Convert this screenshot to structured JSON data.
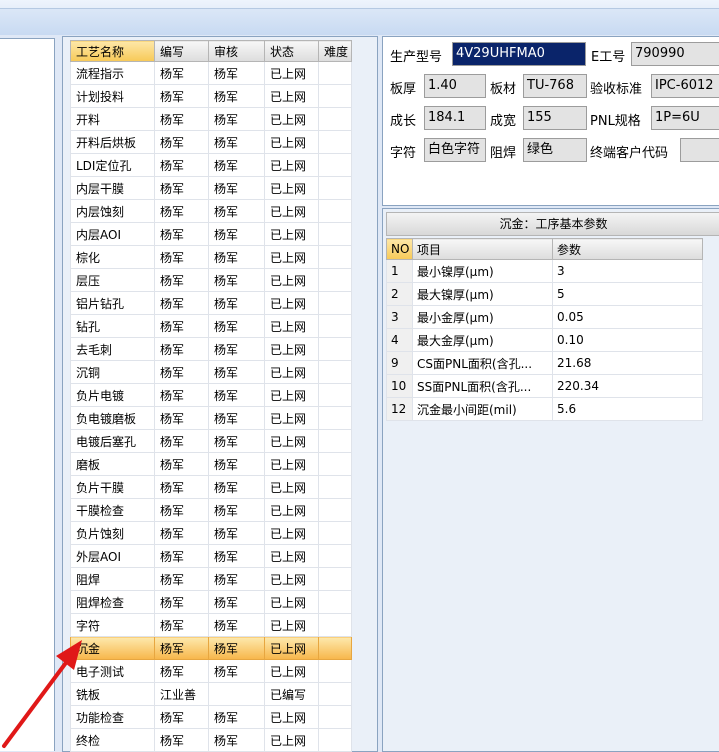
{
  "process_table": {
    "headers": [
      "工艺名称",
      "编写",
      "审核",
      "状态",
      "难度"
    ],
    "rows": [
      [
        "流程指示",
        "杨军",
        "杨军",
        "已上网",
        ""
      ],
      [
        "计划投料",
        "杨军",
        "杨军",
        "已上网",
        ""
      ],
      [
        "开料",
        "杨军",
        "杨军",
        "已上网",
        ""
      ],
      [
        "开料后烘板",
        "杨军",
        "杨军",
        "已上网",
        ""
      ],
      [
        "LDI定位孔",
        "杨军",
        "杨军",
        "已上网",
        ""
      ],
      [
        "内层干膜",
        "杨军",
        "杨军",
        "已上网",
        ""
      ],
      [
        "内层蚀刻",
        "杨军",
        "杨军",
        "已上网",
        ""
      ],
      [
        "内层AOI",
        "杨军",
        "杨军",
        "已上网",
        ""
      ],
      [
        "棕化",
        "杨军",
        "杨军",
        "已上网",
        ""
      ],
      [
        "层压",
        "杨军",
        "杨军",
        "已上网",
        ""
      ],
      [
        "铝片钻孔",
        "杨军",
        "杨军",
        "已上网",
        ""
      ],
      [
        "钻孔",
        "杨军",
        "杨军",
        "已上网",
        ""
      ],
      [
        "去毛刺",
        "杨军",
        "杨军",
        "已上网",
        ""
      ],
      [
        "沉铜",
        "杨军",
        "杨军",
        "已上网",
        ""
      ],
      [
        "负片电镀",
        "杨军",
        "杨军",
        "已上网",
        ""
      ],
      [
        "负电镀磨板",
        "杨军",
        "杨军",
        "已上网",
        ""
      ],
      [
        "电镀后塞孔",
        "杨军",
        "杨军",
        "已上网",
        ""
      ],
      [
        "磨板",
        "杨军",
        "杨军",
        "已上网",
        ""
      ],
      [
        "负片干膜",
        "杨军",
        "杨军",
        "已上网",
        ""
      ],
      [
        "干膜检查",
        "杨军",
        "杨军",
        "已上网",
        ""
      ],
      [
        "负片蚀刻",
        "杨军",
        "杨军",
        "已上网",
        ""
      ],
      [
        "外层AOI",
        "杨军",
        "杨军",
        "已上网",
        ""
      ],
      [
        "阻焊",
        "杨军",
        "杨军",
        "已上网",
        ""
      ],
      [
        "阻焊检查",
        "杨军",
        "杨军",
        "已上网",
        ""
      ],
      [
        "字符",
        "杨军",
        "杨军",
        "已上网",
        ""
      ],
      [
        "沉金",
        "杨军",
        "杨军",
        "已上网",
        ""
      ],
      [
        "电子测试",
        "杨军",
        "杨军",
        "已上网",
        ""
      ],
      [
        "铣板",
        "江业善",
        "",
        "已编写",
        ""
      ],
      [
        "功能检查",
        "杨军",
        "杨军",
        "已上网",
        ""
      ],
      [
        "终检",
        "杨军",
        "杨军",
        "已上网",
        ""
      ]
    ],
    "selected_row": 25
  },
  "info": {
    "model_label": "生产型号",
    "model_value": "4V29UHFMA0",
    "eno_label": "E工号",
    "eno_value": "790990",
    "thickness_label": "板厚",
    "thickness_value": "1.40",
    "material_label": "板材",
    "material_value": "TU-768",
    "standard_label": "验收标准",
    "standard_value": "IPC-6012",
    "length_label": "成长",
    "length_value": "184.1",
    "width_label": "成宽",
    "width_value": "155",
    "pnl_label": "PNL规格",
    "pnl_value": "1P=6U",
    "char_label": "字符",
    "char_value": "白色字符",
    "mask_label": "阻焊",
    "mask_value": "绿色",
    "customer_label": "终端客户代码",
    "customer_value": ""
  },
  "params": {
    "title": "沉金：工序基本参数",
    "headers": [
      "NO",
      "项目",
      "参数"
    ],
    "rows": [
      [
        "1",
        "最小镍厚(μm)",
        "3"
      ],
      [
        "2",
        "最大镍厚(μm)",
        "5"
      ],
      [
        "3",
        "最小金厚(μm)",
        "0.05"
      ],
      [
        "4",
        "最大金厚(μm)",
        "0.10"
      ],
      [
        "9",
        "CS面PNL面积(含孔...",
        "21.68"
      ],
      [
        "10",
        "SS面PNL面积(含孔...",
        "220.34"
      ],
      [
        "12",
        "沉金最小间距(mil)",
        "5.6"
      ]
    ]
  },
  "colors": {
    "selected_row": "#f7b64a",
    "annotation_arrow": "#e01818",
    "highlight_field": "#0a246a"
  }
}
